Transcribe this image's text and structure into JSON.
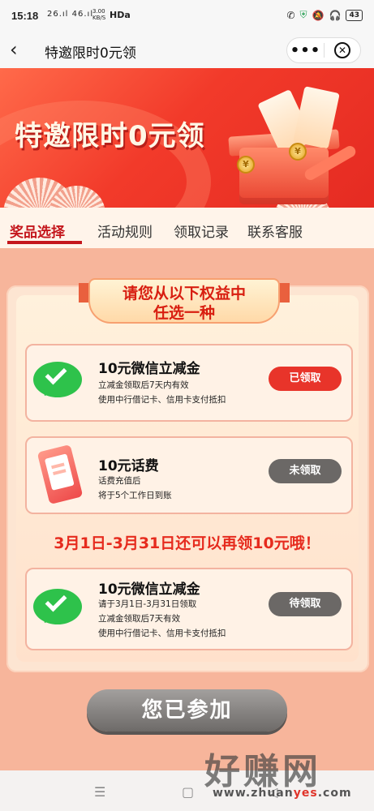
{
  "status_bar": {
    "time": "15:18",
    "signal": "26.ıl 46.ıl",
    "speed_value": "3.00",
    "speed_unit": "KB/S",
    "network": "HDa",
    "battery": "43"
  },
  "nav": {
    "title": "特邀限时0元领"
  },
  "banner": {
    "title": "特邀限时0元领",
    "coin_symbol": "¥"
  },
  "tabs": [
    {
      "label": "奖品选择",
      "active": true
    },
    {
      "label": "活动规则",
      "active": false
    },
    {
      "label": "领取记录",
      "active": false
    },
    {
      "label": "联系客服",
      "active": false
    }
  ],
  "choose": {
    "line1": "请您从以下权益中",
    "line2": "任选一种"
  },
  "items": [
    {
      "name": "10元微信立减金",
      "desc": [
        "立减金领取后7天内有效",
        "使用中行借记卡、信用卡支付抵扣"
      ],
      "button": "已领取",
      "button_color": "#e8342a"
    },
    {
      "name": "10元话费",
      "desc": [
        "话费充值后",
        "将于5个工作日到账"
      ],
      "button": "未领取",
      "button_color": "#6b6866"
    },
    {
      "name": "10元微信立减金",
      "desc": [
        "请于3月1日-3月31日领取",
        "立减金领取后7天有效",
        "使用中行借记卡、信用卡支付抵扣"
      ],
      "button": "待领取",
      "button_color": "#6b6866"
    }
  ],
  "promo": "3月1日-3月31日还可以再领10元哦！",
  "join_button": "您已参加",
  "watermark": {
    "text": "好赚网",
    "url_prefix": "www.zhuan",
    "url_highlight": "yes",
    "url_suffix": ".com"
  },
  "colors": {
    "accent": "#c4161c",
    "wechat_green": "#2ec24b",
    "banner_red": "#f23a2a"
  }
}
